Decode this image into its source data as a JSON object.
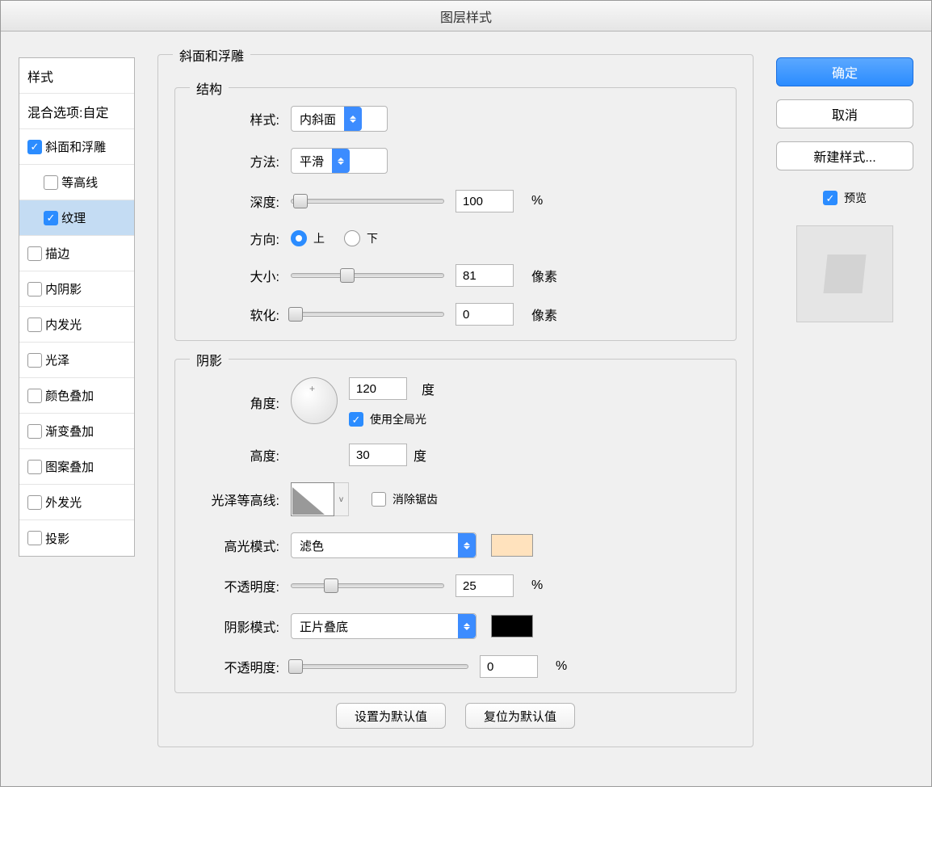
{
  "title": "图层样式",
  "sidebar": {
    "styles_header": "样式",
    "blend_header": "混合选项:自定",
    "items": [
      {
        "label": "斜面和浮雕",
        "checked": true,
        "selected": false,
        "sub": false
      },
      {
        "label": "等高线",
        "checked": false,
        "selected": false,
        "sub": true
      },
      {
        "label": "纹理",
        "checked": true,
        "selected": true,
        "sub": true
      },
      {
        "label": "描边",
        "checked": false,
        "selected": false,
        "sub": false
      },
      {
        "label": "内阴影",
        "checked": false,
        "selected": false,
        "sub": false
      },
      {
        "label": "内发光",
        "checked": false,
        "selected": false,
        "sub": false
      },
      {
        "label": "光泽",
        "checked": false,
        "selected": false,
        "sub": false
      },
      {
        "label": "颜色叠加",
        "checked": false,
        "selected": false,
        "sub": false
      },
      {
        "label": "渐变叠加",
        "checked": false,
        "selected": false,
        "sub": false
      },
      {
        "label": "图案叠加",
        "checked": false,
        "selected": false,
        "sub": false
      },
      {
        "label": "外发光",
        "checked": false,
        "selected": false,
        "sub": false
      },
      {
        "label": "投影",
        "checked": false,
        "selected": false,
        "sub": false
      }
    ]
  },
  "outer_legend": "斜面和浮雕",
  "structure": {
    "legend": "结构",
    "style_label": "样式:",
    "style_value": "内斜面",
    "technique_label": "方法:",
    "technique_value": "平滑",
    "depth_label": "深度:",
    "depth_value": "100",
    "depth_unit": "%",
    "direction_label": "方向:",
    "direction_up": "上",
    "direction_down": "下",
    "size_label": "大小:",
    "size_value": "81",
    "size_unit": "像素",
    "soften_label": "软化:",
    "soften_value": "0",
    "soften_unit": "像素"
  },
  "shading": {
    "legend": "阴影",
    "angle_label": "角度:",
    "angle_value": "120",
    "angle_unit": "度",
    "global_light_label": "使用全局光",
    "global_light_checked": true,
    "altitude_label": "高度:",
    "altitude_value": "30",
    "altitude_unit": "度",
    "gloss_label": "光泽等高线:",
    "antialias_label": "消除锯齿",
    "antialias_checked": false,
    "highlight_mode_label": "高光模式:",
    "highlight_mode_value": "滤色",
    "highlight_color": "#ffe2bd",
    "highlight_opacity_label": "不透明度:",
    "highlight_opacity_value": "25",
    "highlight_opacity_unit": "%",
    "shadow_mode_label": "阴影模式:",
    "shadow_mode_value": "正片叠底",
    "shadow_color": "#000000",
    "shadow_opacity_label": "不透明度:",
    "shadow_opacity_value": "0",
    "shadow_opacity_unit": "%"
  },
  "bottom": {
    "set_default": "设置为默认值",
    "reset_default": "复位为默认值"
  },
  "right": {
    "ok": "确定",
    "cancel": "取消",
    "new_style": "新建样式...",
    "preview_label": "预览",
    "preview_checked": true
  }
}
